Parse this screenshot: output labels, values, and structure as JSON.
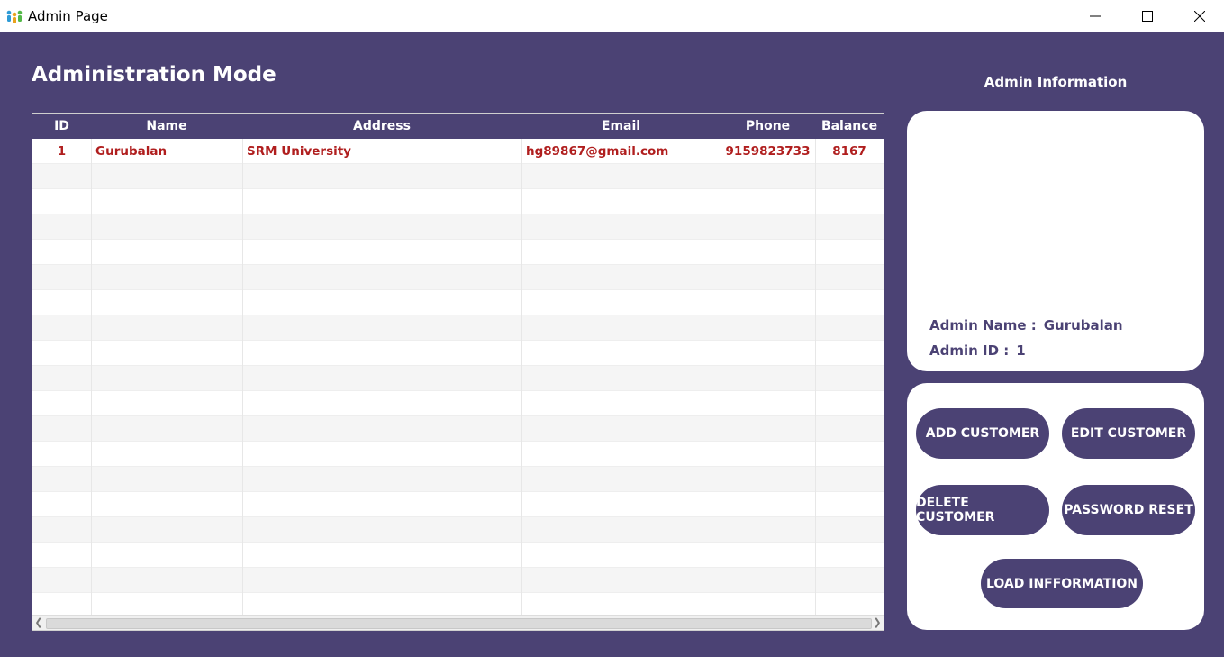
{
  "window": {
    "title": "Admin Page"
  },
  "page": {
    "title": "Administration Mode"
  },
  "table": {
    "columns": [
      "ID",
      "Name",
      "Address",
      "Email",
      "Phone",
      "Balance"
    ],
    "rows": [
      [
        "1",
        "Gurubalan",
        "SRM University",
        "hg89867@gmail.com",
        "9159823733",
        "8167"
      ]
    ]
  },
  "admin_info": {
    "heading": "Admin Information",
    "name_label": "Admin Name :",
    "name_value": "Gurubalan",
    "id_label": "Admin ID :",
    "id_value": "1"
  },
  "buttons": {
    "add_customer": "ADD CUSTOMER",
    "edit_customer": "EDIT CUSTOMER",
    "delete_customer": "DELETE CUSTOMER",
    "password_reset": "PASSWORD RESET",
    "load_information": "LOAD INFFORMATION"
  },
  "colors": {
    "primary": "#4b4274",
    "row_text": "#b01e1e",
    "panel": "#ffffff"
  }
}
